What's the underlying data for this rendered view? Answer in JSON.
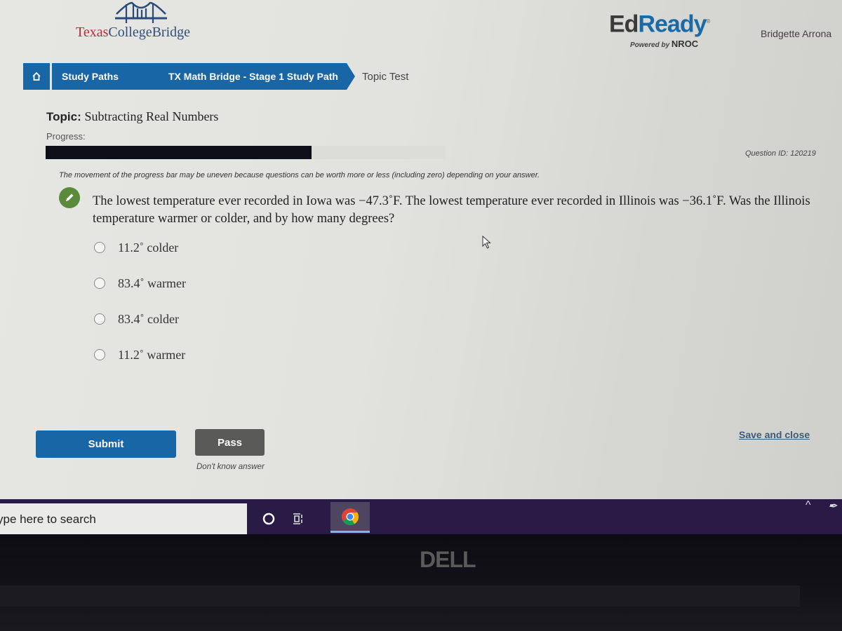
{
  "header": {
    "brand_left": {
      "part1": "Texas",
      "part2": "CollegeBridge"
    },
    "brand_right": {
      "ed": "Ed",
      "ready": "Ready",
      "trademark": "®",
      "powered_by": "Powered by",
      "nroc": "NROC"
    },
    "user_name": "Bridgette Arrona"
  },
  "breadcrumb": {
    "home_icon": "home-icon",
    "items": [
      {
        "label": "Study Paths"
      },
      {
        "label": "TX Math Bridge - Stage 1 Study Path"
      }
    ],
    "current": "Topic Test"
  },
  "topic": {
    "label": "Topic:",
    "name": "Subtracting Real Numbers"
  },
  "progress": {
    "label": "Progress:",
    "percent": 66.5,
    "note": "The movement of the progress bar may be uneven because questions can be worth more or less (including zero) depending on your answer."
  },
  "question": {
    "id_text": "Question ID: 120219",
    "icon": "pencil-icon",
    "text": "The lowest temperature ever recorded in Iowa was −47.3˚F. The lowest temperature ever recorded in Illinois was −36.1˚F. Was the Illinois temperature warmer or colder, and by how many degrees?",
    "options": [
      {
        "label": "11.2˚ colder",
        "selected": false
      },
      {
        "label": "83.4˚ warmer",
        "selected": false
      },
      {
        "label": "83.4˚ colder",
        "selected": false
      },
      {
        "label": "11.2˚ warmer",
        "selected": false
      }
    ]
  },
  "actions": {
    "submit": "Submit",
    "pass": "Pass",
    "pass_note": "Don't know answer",
    "save_close": "Save and close"
  },
  "taskbar": {
    "search_placeholder": "ype here to search",
    "apps": [
      "cortana-icon",
      "task-view-icon",
      "chrome-icon"
    ],
    "tray_chevron": "^"
  },
  "hardware": {
    "brand": "DELL"
  }
}
